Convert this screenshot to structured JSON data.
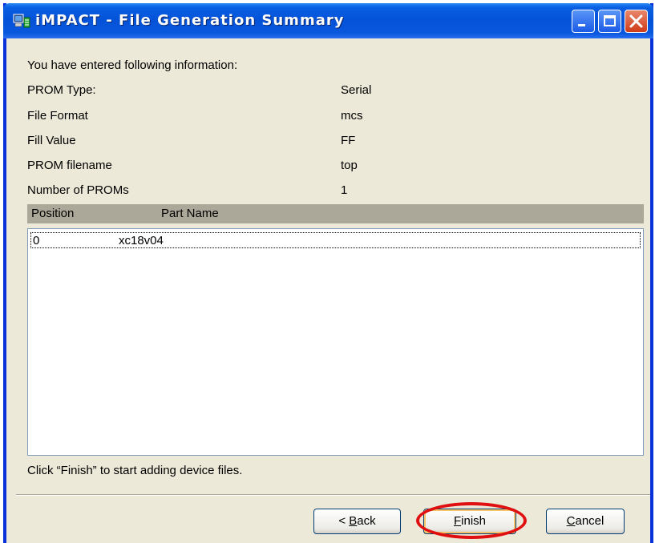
{
  "window": {
    "title": "iMPACT - File Generation Summary",
    "icons": {
      "app": "impact-app-icon",
      "minimize": "minimize-icon",
      "maximize": "maximize-icon",
      "close": "close-icon"
    }
  },
  "summary": {
    "intro": "You have entered following information:",
    "rows": [
      {
        "label": "PROM Type:",
        "value": "Serial"
      },
      {
        "label": "File Format",
        "value": "mcs"
      },
      {
        "label": "Fill Value",
        "value": "FF"
      },
      {
        "label": "PROM filename",
        "value": "top"
      },
      {
        "label": "Number of PROMs",
        "value": "1"
      }
    ]
  },
  "device_list": {
    "columns": [
      "Position",
      "Part Name"
    ],
    "rows": [
      {
        "position": "0",
        "part_name": "xc18v04"
      }
    ]
  },
  "hint": "Click “Finish” to start adding device files.",
  "buttons": {
    "back": {
      "pre": "< ",
      "mnemonic": "B",
      "rest": "ack"
    },
    "finish": {
      "pre": "",
      "mnemonic": "F",
      "rest": "inish"
    },
    "cancel": {
      "pre": "",
      "mnemonic": "C",
      "rest": "ancel"
    }
  },
  "colors": {
    "titlebar": "#0352d8",
    "dialog_bg": "#ece9d8",
    "list_header_bg": "#aca899",
    "highlight_ellipse": "#e01010"
  }
}
